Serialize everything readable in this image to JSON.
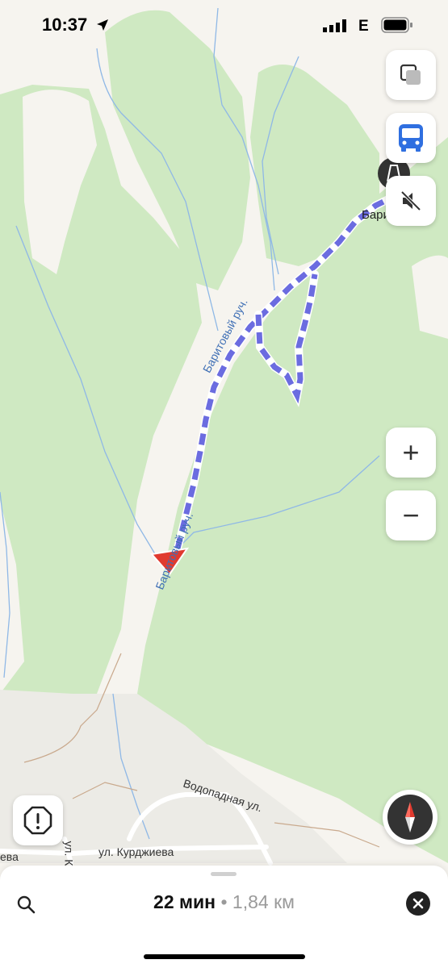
{
  "status_bar": {
    "time": "10:37",
    "network": "E"
  },
  "map": {
    "stream_label_1": "Баритовый руч.",
    "stream_label_2": "Баритовый руч.",
    "place_label": "Баритовый",
    "street_label_1": "Водопадная ул.",
    "street_label_2": "ул. Курджиева",
    "street_label_3": "ул. К",
    "street_label_4": "ева"
  },
  "controls": {
    "layers_icon": "layers-icon",
    "transit_icon": "bus-icon",
    "sound_icon": "sound-off-icon",
    "zoom_in_label": "+",
    "zoom_out_label": "−",
    "hazard_icon": "hazard-icon",
    "compass_icon": "compass-icon"
  },
  "route": {
    "duration": "22 мин",
    "separator": "•",
    "distance": "1,84 км"
  },
  "colors": {
    "route": "#6b6ce0",
    "forest": "#cfe9c2",
    "water": "#8fb8e6",
    "arrow": "#e03a2f"
  }
}
